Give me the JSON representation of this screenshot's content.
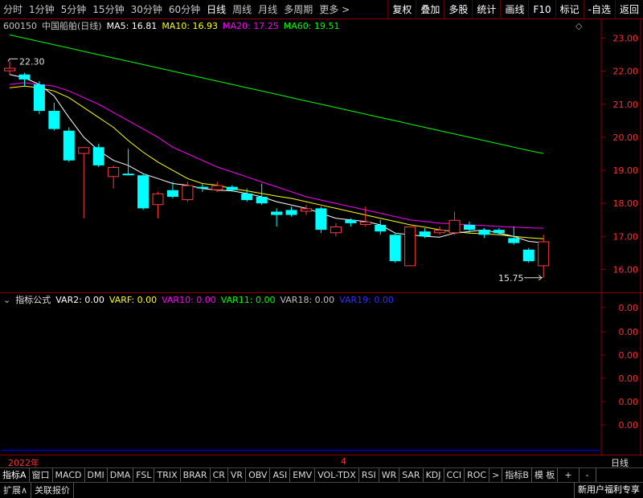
{
  "toolbar": {
    "periods": [
      "分时",
      "1分钟",
      "5分钟",
      "15分钟",
      "30分钟",
      "60分钟",
      "日线",
      "周线",
      "月线",
      "多周期",
      "更多 >"
    ],
    "active_period": "日线",
    "actions": [
      "复权",
      "叠加",
      "多股",
      "统计",
      "画线",
      "F10",
      "标记",
      "-自选",
      "返回"
    ]
  },
  "stock": {
    "code": "600150",
    "name": "中国船舶(日线)",
    "ma5_label": "MA5: 16.81",
    "ma10_label": "MA10: 16.93",
    "ma20_label": "MA20: 17.25",
    "ma60_label": "MA60: 19.51"
  },
  "indicator": {
    "name": "指标公式",
    "var2": "VAR2: 0.00",
    "varf": "VARF: 0.00",
    "var10": "VAR10: 0.00",
    "var11": "VAR11: 0.00",
    "var18": "VAR18: 0.00",
    "var19": "VAR19: 0.00"
  },
  "time_axis": {
    "year_label": "2022年",
    "month_label": "4",
    "period_label": "日线"
  },
  "tabs": [
    "指标A",
    "窗口",
    "MACD",
    "DMI",
    "DMA",
    "FSL",
    "TRIX",
    "BRAR",
    "CR",
    "VR",
    "OBV",
    "ASI",
    "EMV",
    "VOL-TDX",
    "RSI",
    "WR",
    "SAR",
    "KDJ",
    "CCI",
    "ROC",
    ">",
    "指标B",
    "模 板",
    "+",
    "-"
  ],
  "status": {
    "expand": "扩展∧",
    "related": "关联报价",
    "promo": "新用户福利专享"
  },
  "colors": {
    "up": "#ff3c3c",
    "down": "#00ffff",
    "ma5": "#ffffff",
    "ma10": "#ffff00",
    "ma20": "#ff00ff",
    "ma60": "#00ff00",
    "frame": "#8b0000",
    "axis_text": "#ff3030"
  },
  "chart_data": {
    "type": "candlestick",
    "price_axis": {
      "ylim": [
        15.6,
        23.3
      ],
      "ticks": [
        "23.00",
        "22.00",
        "21.00",
        "20.00",
        "19.00",
        "18.00",
        "17.00",
        "16.00"
      ]
    },
    "indicator_axis": {
      "ticks": [
        "0.00",
        "0.00",
        "0.00",
        "0.00",
        "0.00",
        "0.00"
      ]
    },
    "annotations": {
      "high": "22.30",
      "low": "15.75"
    },
    "candles": [
      {
        "o": 22.0,
        "h": 22.3,
        "l": 21.9,
        "c": 22.1
      },
      {
        "o": 21.9,
        "h": 21.95,
        "l": 21.55,
        "c": 21.75
      },
      {
        "o": 21.6,
        "h": 21.7,
        "l": 20.7,
        "c": 20.8
      },
      {
        "o": 20.8,
        "h": 21.05,
        "l": 20.2,
        "c": 20.25
      },
      {
        "o": 20.2,
        "h": 20.3,
        "l": 19.25,
        "c": 19.3
      },
      {
        "o": 19.5,
        "h": 19.7,
        "l": 17.55,
        "c": 19.7
      },
      {
        "o": 19.7,
        "h": 19.8,
        "l": 19.1,
        "c": 19.15
      },
      {
        "o": 18.8,
        "h": 19.15,
        "l": 18.45,
        "c": 19.1
      },
      {
        "o": 18.9,
        "h": 19.65,
        "l": 18.85,
        "c": 18.85
      },
      {
        "o": 18.85,
        "h": 18.9,
        "l": 17.8,
        "c": 17.85
      },
      {
        "o": 17.95,
        "h": 18.35,
        "l": 17.55,
        "c": 18.3
      },
      {
        "o": 18.4,
        "h": 18.65,
        "l": 18.15,
        "c": 18.2
      },
      {
        "o": 18.1,
        "h": 18.65,
        "l": 18.05,
        "c": 18.55
      },
      {
        "o": 18.5,
        "h": 18.6,
        "l": 18.35,
        "c": 18.45
      },
      {
        "o": 18.4,
        "h": 18.65,
        "l": 18.35,
        "c": 18.55
      },
      {
        "o": 18.5,
        "h": 18.55,
        "l": 18.35,
        "c": 18.4
      },
      {
        "o": 18.3,
        "h": 18.45,
        "l": 18.05,
        "c": 18.1
      },
      {
        "o": 18.2,
        "h": 18.6,
        "l": 17.95,
        "c": 18.0
      },
      {
        "o": 17.75,
        "h": 17.85,
        "l": 17.3,
        "c": 17.65
      },
      {
        "o": 17.8,
        "h": 17.9,
        "l": 17.6,
        "c": 17.65
      },
      {
        "o": 17.75,
        "h": 17.95,
        "l": 17.65,
        "c": 17.85
      },
      {
        "o": 17.85,
        "h": 17.9,
        "l": 17.1,
        "c": 17.2
      },
      {
        "o": 17.1,
        "h": 17.4,
        "l": 17.0,
        "c": 17.3
      },
      {
        "o": 17.5,
        "h": 17.55,
        "l": 17.3,
        "c": 17.4
      },
      {
        "o": 17.35,
        "h": 17.9,
        "l": 17.3,
        "c": 17.45
      },
      {
        "o": 17.35,
        "h": 17.5,
        "l": 17.05,
        "c": 17.15
      },
      {
        "o": 17.05,
        "h": 17.1,
        "l": 16.2,
        "c": 16.25
      },
      {
        "o": 16.1,
        "h": 17.3,
        "l": 16.1,
        "c": 17.3
      },
      {
        "o": 17.15,
        "h": 17.25,
        "l": 16.95,
        "c": 17.0
      },
      {
        "o": 17.1,
        "h": 17.3,
        "l": 17.05,
        "c": 17.2
      },
      {
        "o": 17.1,
        "h": 17.75,
        "l": 17.05,
        "c": 17.5
      },
      {
        "o": 17.35,
        "h": 17.45,
        "l": 17.1,
        "c": 17.2
      },
      {
        "o": 17.2,
        "h": 17.25,
        "l": 16.95,
        "c": 17.05
      },
      {
        "o": 17.2,
        "h": 17.25,
        "l": 17.05,
        "c": 17.1
      },
      {
        "o": 16.95,
        "h": 17.3,
        "l": 16.75,
        "c": 16.8
      },
      {
        "o": 16.6,
        "h": 16.65,
        "l": 16.2,
        "c": 16.25
      },
      {
        "o": 16.1,
        "h": 17.05,
        "l": 15.75,
        "c": 16.85
      }
    ],
    "ma5": [
      21.9,
      21.8,
      21.6,
      21.25,
      20.6,
      20.0,
      19.6,
      19.3,
      19.15,
      18.9,
      18.75,
      18.6,
      18.55,
      18.45,
      18.4,
      18.38,
      18.3,
      18.2,
      18.05,
      17.95,
      17.85,
      17.7,
      17.55,
      17.5,
      17.45,
      17.35,
      17.1,
      17.05,
      17.0,
      16.98,
      17.1,
      17.15,
      17.2,
      17.1,
      17.0,
      16.85,
      16.81
    ],
    "ma10": [
      21.5,
      21.55,
      21.5,
      21.4,
      21.2,
      20.9,
      20.6,
      20.3,
      19.9,
      19.55,
      19.25,
      19.0,
      18.75,
      18.6,
      18.55,
      18.45,
      18.38,
      18.3,
      18.22,
      18.15,
      18.05,
      17.95,
      17.85,
      17.75,
      17.65,
      17.55,
      17.45,
      17.35,
      17.28,
      17.2,
      17.15,
      17.1,
      17.08,
      17.05,
      17.0,
      16.96,
      16.93
    ],
    "ma20": [
      21.6,
      21.65,
      21.6,
      21.55,
      21.4,
      21.2,
      21.0,
      20.75,
      20.5,
      20.25,
      20.0,
      19.7,
      19.5,
      19.3,
      19.1,
      18.95,
      18.8,
      18.65,
      18.5,
      18.35,
      18.2,
      18.1,
      18.0,
      17.9,
      17.8,
      17.7,
      17.6,
      17.5,
      17.45,
      17.4,
      17.38,
      17.35,
      17.33,
      17.3,
      17.28,
      17.26,
      17.25
    ],
    "ma60": [
      23.1,
      23.0,
      22.9,
      22.8,
      22.7,
      22.6,
      22.5,
      22.4,
      22.3,
      22.2,
      22.1,
      22.0,
      21.9,
      21.8,
      21.7,
      21.6,
      21.5,
      21.4,
      21.3,
      21.2,
      21.1,
      21.0,
      20.9,
      20.8,
      20.7,
      20.6,
      20.5,
      20.4,
      20.3,
      20.2,
      20.1,
      20.0,
      19.9,
      19.8,
      19.7,
      19.6,
      19.51
    ]
  }
}
